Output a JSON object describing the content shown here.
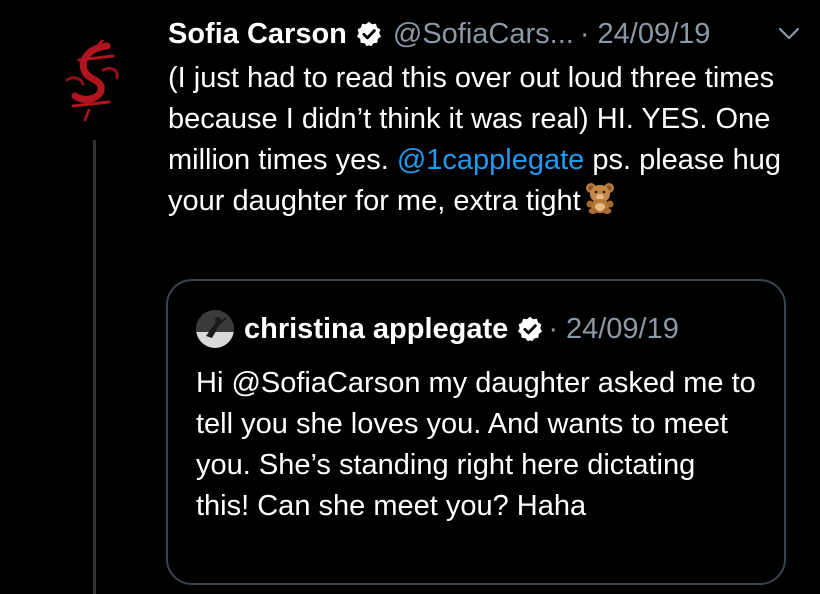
{
  "tweet": {
    "display_name": "Sofia Carson",
    "handle": "@SofiaCars...",
    "separator": "·",
    "date": "24/09/19",
    "text_part1": "(I just had to read this over out loud three times because I didn’t think it was real) HI. YES. One million times yes. ",
    "mention": "@1capplegate",
    "text_part2": " ps. please hug your daughter for me, extra tight",
    "avatar_icon": "gothic-s-logo-icon",
    "chevron_icon": "chevron-down-icon"
  },
  "quote": {
    "display_name": "christina applegate",
    "separator": "·",
    "date": "24/09/19",
    "text": "Hi @SofiaCarson my daughter asked me to tell you she loves you. And wants to meet you. She’s standing right here dictating this! Can she meet you? Haha"
  },
  "colors": {
    "background": "#000000",
    "text": "#ffffff",
    "secondary": "#8b98a5",
    "link": "#1d9bf0",
    "border": "#38444d"
  }
}
